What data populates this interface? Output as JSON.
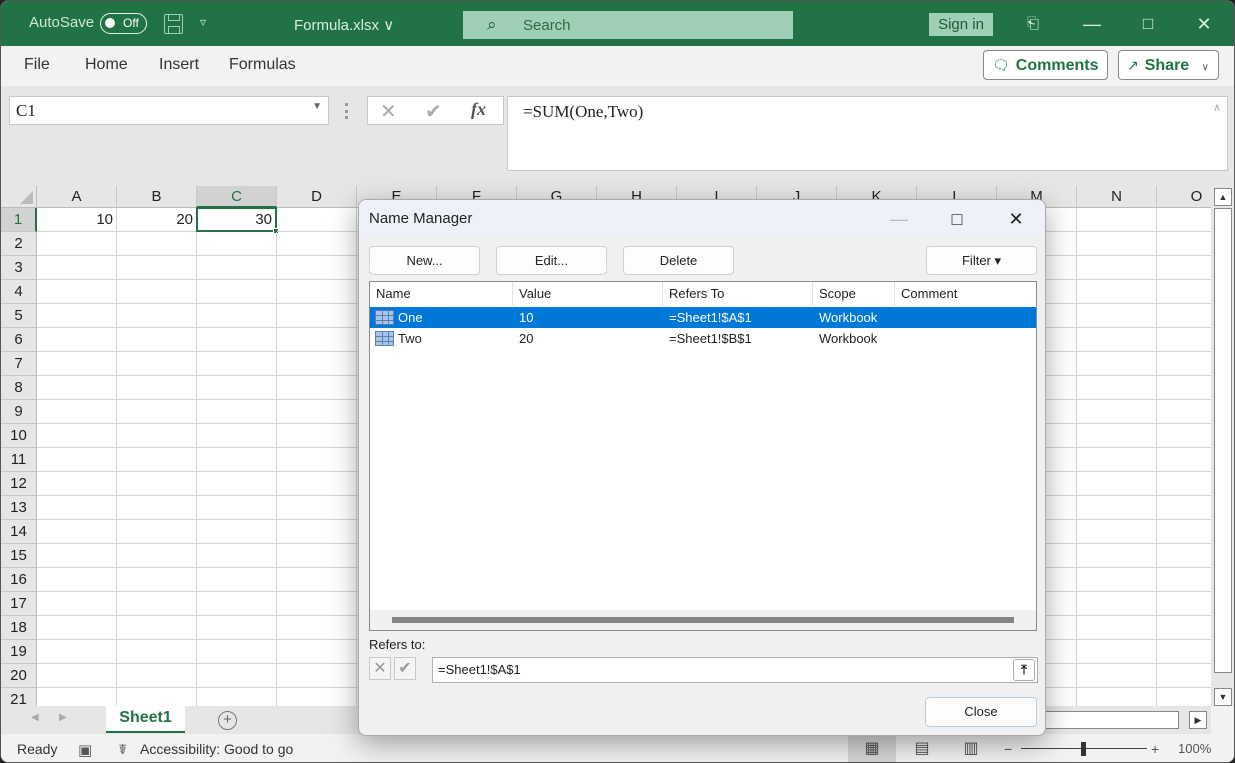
{
  "titlebar": {
    "autosave_label": "AutoSave",
    "autosave_state": "Off",
    "filename": "Formula.xlsx",
    "filename_chevron": "∨",
    "search_placeholder": "Search",
    "sign_in": "Sign in",
    "icons": {
      "search": "search-icon",
      "save": "save-icon",
      "ribbon_display": "ribbon-display-icon",
      "minimize": "minimize-icon",
      "maximize": "maximize-icon",
      "close": "close-icon"
    }
  },
  "menu": {
    "items": [
      "File",
      "Home",
      "Insert",
      "Formulas"
    ],
    "comments_label": "Comments",
    "share_label": "Share"
  },
  "formula_bar": {
    "name_box": "C1",
    "cancel_glyph": "✕",
    "enter_glyph": "✔",
    "fx_label": "fx",
    "formula": "=SUM(One,Two)"
  },
  "grid": {
    "columns": [
      "A",
      "B",
      "C",
      "D",
      "E",
      "F",
      "G",
      "H",
      "I",
      "J",
      "K",
      "L",
      "M",
      "N",
      "O"
    ],
    "rows": [
      "1",
      "2",
      "3",
      "4",
      "5",
      "6",
      "7",
      "8",
      "9",
      "10",
      "11",
      "12",
      "13",
      "14",
      "15",
      "16",
      "17",
      "18",
      "19",
      "20",
      "21"
    ],
    "selected_cell": "C1",
    "cells": {
      "A1": "10",
      "B1": "20",
      "C1": "30"
    }
  },
  "sheets": {
    "tabs": [
      "Sheet1"
    ],
    "active": "Sheet1"
  },
  "status": {
    "ready": "Ready",
    "accessibility": "Accessibility: Good to go",
    "zoom": "100%",
    "zoom_minus": "−",
    "zoom_plus": "+"
  },
  "dialog": {
    "title": "Name Manager",
    "buttons": {
      "new": "New...",
      "edit": "Edit...",
      "delete": "Delete",
      "filter": "Filter ▾",
      "close": "Close"
    },
    "columns": [
      "Name",
      "Value",
      "Refers To",
      "Scope",
      "Comment"
    ],
    "names": [
      {
        "name": "One",
        "value": "10",
        "refers_to": "=Sheet1!$A$1",
        "scope": "Workbook",
        "comment": "",
        "selected": true
      },
      {
        "name": "Two",
        "value": "20",
        "refers_to": "=Sheet1!$B$1",
        "scope": "Workbook",
        "comment": "",
        "selected": false
      }
    ],
    "refers_to_label": "Refers to:",
    "refers_to_value": "=Sheet1!$A$1"
  }
}
